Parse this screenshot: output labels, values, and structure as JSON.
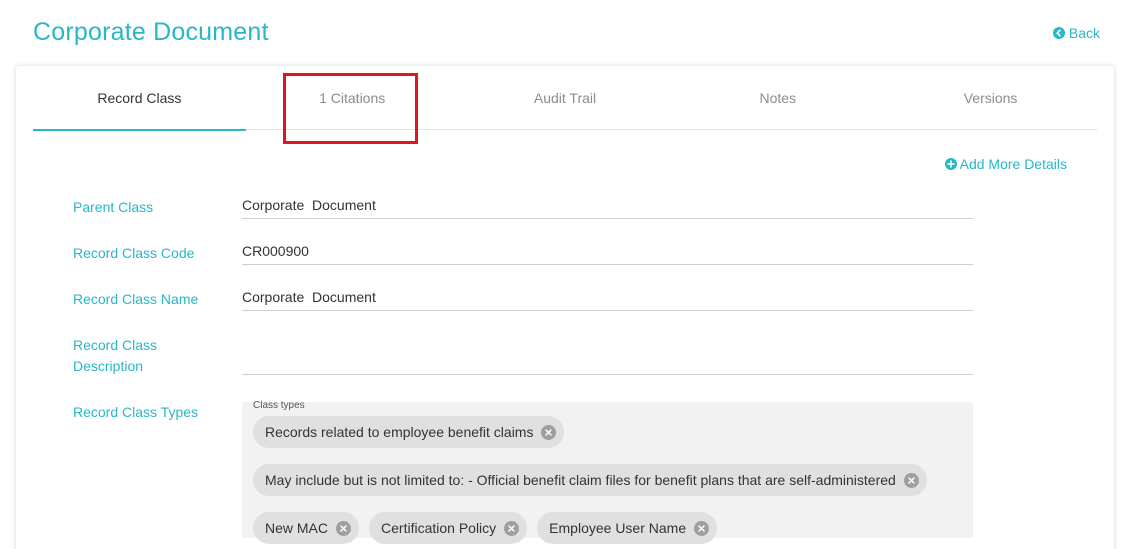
{
  "header": {
    "title": "Corporate Document",
    "back_label": "Back"
  },
  "tabs": [
    {
      "label": "Record Class",
      "active": true
    },
    {
      "label": "1 Citations",
      "active": false
    },
    {
      "label": "Audit Trail",
      "active": false
    },
    {
      "label": "Notes",
      "active": false
    },
    {
      "label": "Versions",
      "active": false
    }
  ],
  "actions": {
    "add_more_details": "Add More Details"
  },
  "fields": {
    "parent_class": {
      "label": "Parent Class",
      "value": "Corporate  Document"
    },
    "record_class_code": {
      "label": "Record Class Code",
      "value": "CR000900"
    },
    "record_class_name": {
      "label": "Record Class Name",
      "value": "Corporate  Document"
    },
    "record_class_description": {
      "label": "Record Class Description",
      "value": ""
    },
    "record_class_types": {
      "label": "Record Class Types",
      "caption": "Class types",
      "chips": [
        "Records related to employee benefit claims",
        "May include but is not limited to: - Official benefit claim files for benefit plans that are self-administered",
        "New MAC",
        "Certification Policy",
        "Employee User Name"
      ]
    }
  },
  "colors": {
    "accent": "#29b6c9",
    "highlight": "#e3141e",
    "chip_bg": "#e0e0e0",
    "chip_close": "#9e9e9e"
  },
  "icons": {
    "back": "arrow-left-circle-icon",
    "add": "plus-circle-icon",
    "chip_remove": "close-circle-icon"
  }
}
